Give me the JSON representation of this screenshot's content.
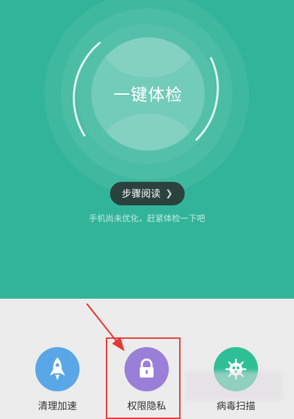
{
  "checkup": {
    "button_label": "一键体检",
    "steps_label": "步骤阅读",
    "hint": "手机尚未优化，赶紧体检一下吧"
  },
  "tools": [
    {
      "label": "清理加速",
      "icon": "rocket-icon",
      "color": "#5aa7e8"
    },
    {
      "label": "权限隐私",
      "icon": "lock-icon",
      "color": "#9a7fd8"
    },
    {
      "label": "病毒扫描",
      "icon": "virus-icon",
      "color": "#2fbf96"
    }
  ],
  "colors": {
    "hero_background": "#32b49a",
    "tray_background": "#ececec",
    "annotation_red": "#e53935"
  }
}
